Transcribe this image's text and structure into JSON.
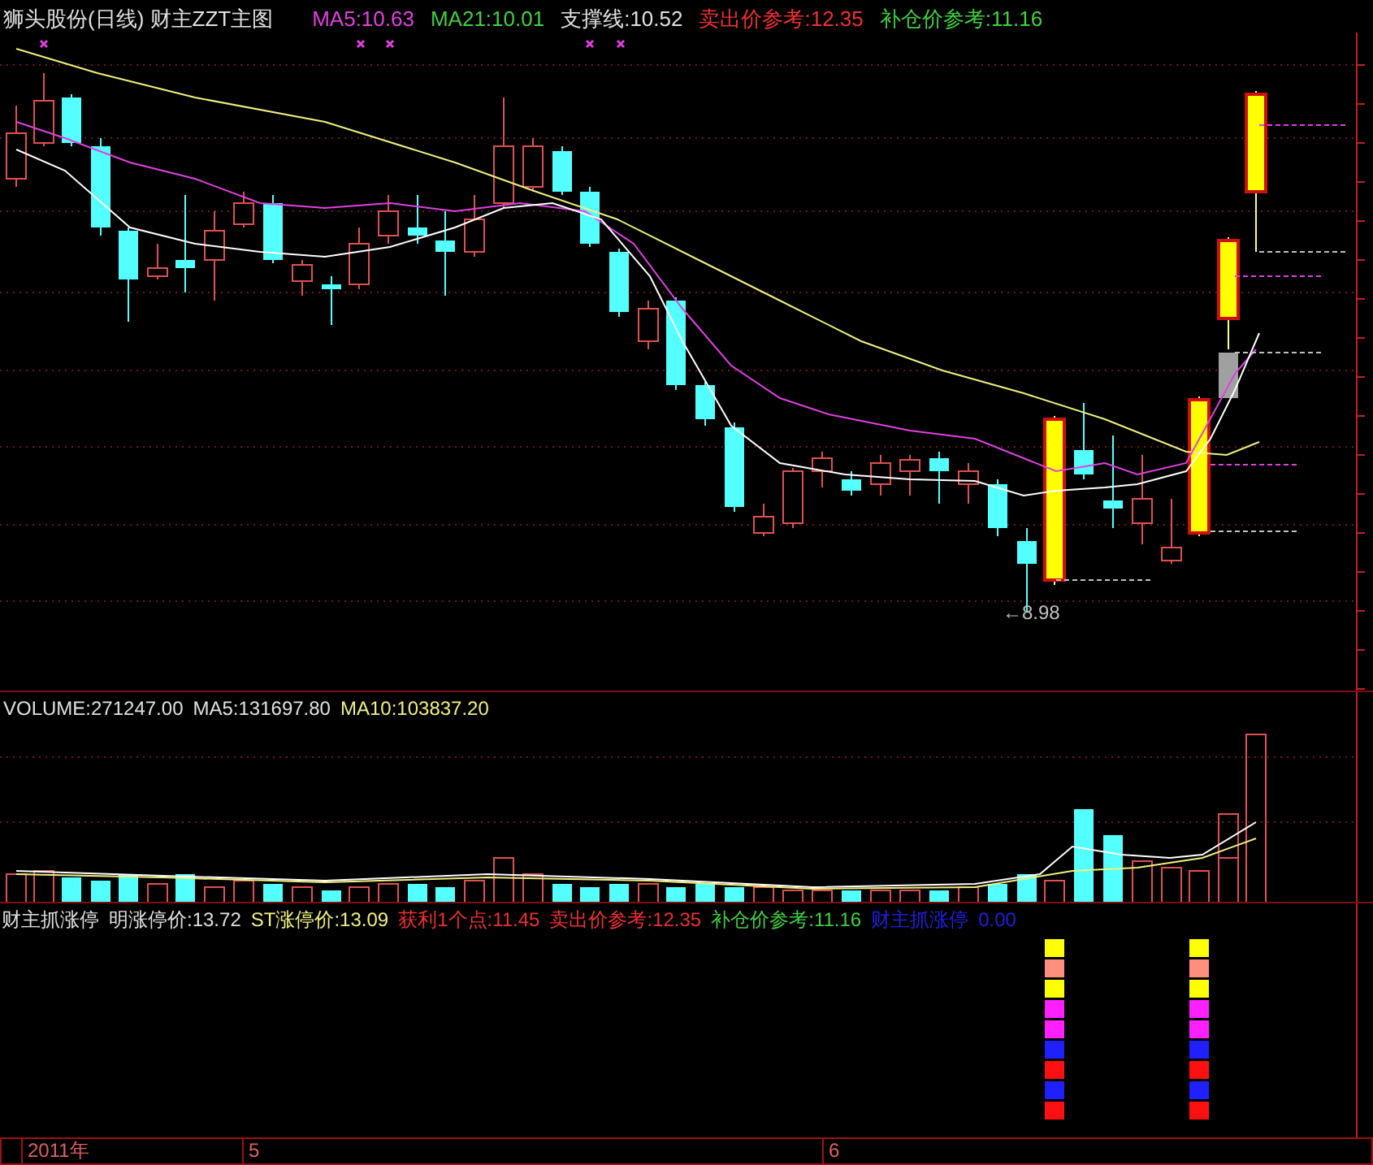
{
  "main_panel": {
    "title": "狮头股份(日线) 财主ZZT主图",
    "legend": [
      {
        "text": "MA5:10.63",
        "color": "#e040e0"
      },
      {
        "text": "MA21:10.01",
        "color": "#40d040"
      },
      {
        "text": "支撑线:10.52",
        "color": "#e0e0e0"
      },
      {
        "text": "卖出价参考:12.35",
        "color": "#f03030"
      },
      {
        "text": "补仓价参考:11.16",
        "color": "#40d040"
      }
    ],
    "low_label": "←8.98"
  },
  "volume_panel": {
    "legend": [
      {
        "text": "VOLUME:271247.00",
        "color": "#e0e0e0"
      },
      {
        "text": "MA5:131697.80",
        "color": "#e0e0e0"
      },
      {
        "text": "MA10:103837.20",
        "color": "#f0f080"
      }
    ]
  },
  "indicator_panel": {
    "legend": [
      {
        "text": "财主抓涨停",
        "color": "#e0e0e0"
      },
      {
        "text": "明涨停价:13.72",
        "color": "#e0e0e0"
      },
      {
        "text": "ST涨停价:13.09",
        "color": "#f0f080"
      },
      {
        "text": "获利1个点:11.45",
        "color": "#f03030"
      },
      {
        "text": "卖出价参考:12.35",
        "color": "#f03030"
      },
      {
        "text": "补仓价参考:11.16",
        "color": "#40d040"
      },
      {
        "text": "财主抓涨停",
        "color": "#2020e0"
      },
      {
        "text": "0.00",
        "color": "#2020e0"
      }
    ]
  },
  "time_axis": [
    "2011年",
    "5",
    "6"
  ]
}
